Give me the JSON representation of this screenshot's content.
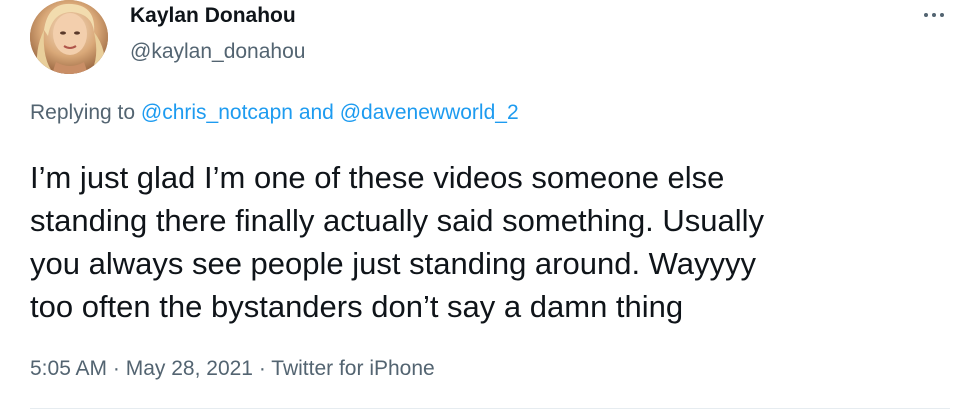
{
  "author": {
    "name": "Kaylan Donahou",
    "handle": "@kaylan_donahou"
  },
  "reply": {
    "prefix": "Replying to ",
    "mention_1": "@chris_notcapn",
    "conjunction": " and ",
    "mention_2": "@davenewworld_2"
  },
  "tweet": {
    "lines": [
      "I’m just glad I’m one of these videos someone else",
      "standing there finally actually said something. Usually",
      "you always see people just standing around. Wayyyy",
      "too often the bystanders don’t say a damn thing"
    ]
  },
  "meta": {
    "time": "5:05 AM",
    "separator_1": " · ",
    "date": "May 28, 2021",
    "separator_2": " · ",
    "source": "Twitter for iPhone"
  },
  "icons": {
    "more": "more-horizontal-icon"
  },
  "colors": {
    "text": "#0f1419",
    "secondary": "#536471",
    "accent": "#1d9bf0"
  }
}
